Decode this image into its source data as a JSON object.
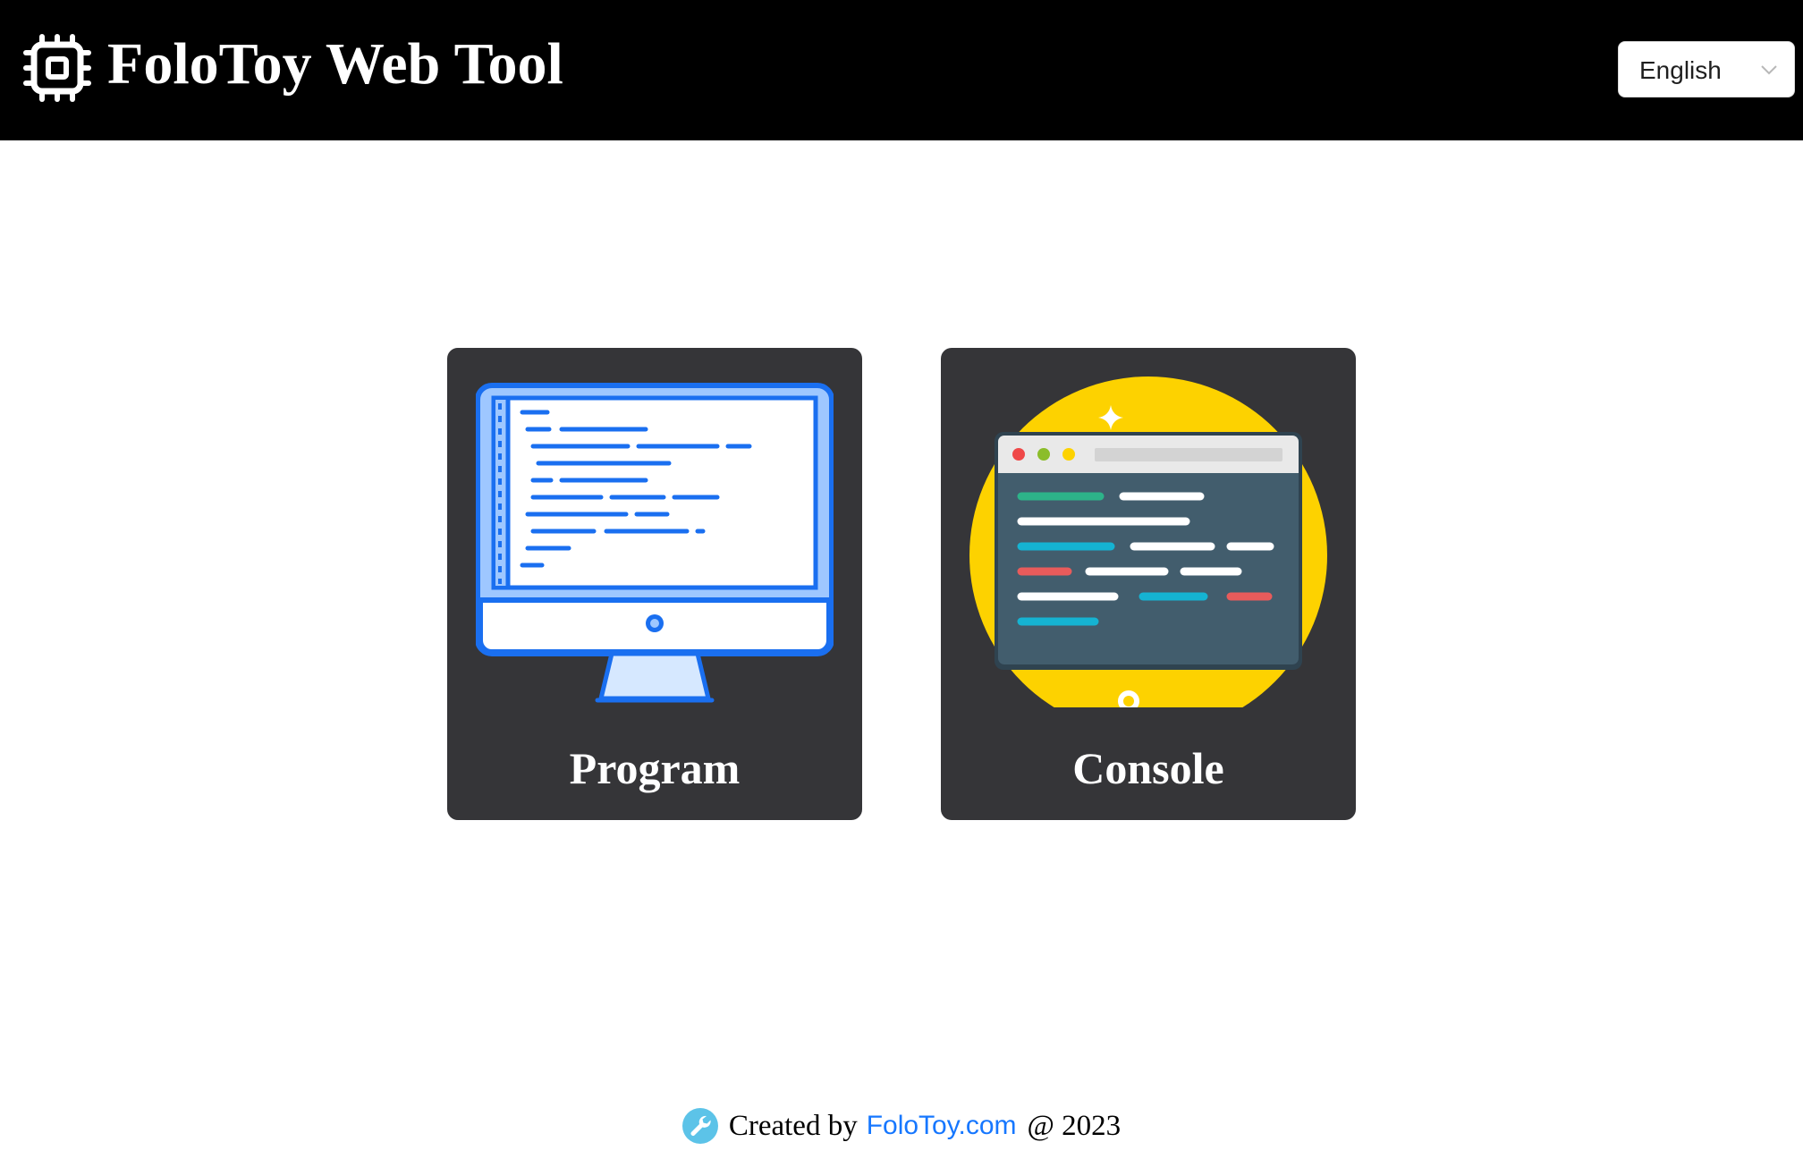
{
  "header": {
    "title": "FoloToy Web Tool",
    "logo_icon": "chip-icon",
    "language_select": {
      "value": "English",
      "icon": "chevron-down-icon"
    }
  },
  "cards": [
    {
      "label": "Program",
      "icon": "monitor-code-icon"
    },
    {
      "label": "Console",
      "icon": "terminal-window-icon"
    }
  ],
  "footer": {
    "prefix": "Created by",
    "link_text": "FoloToy.com",
    "suffix": "@ 2023",
    "icon": "wrench-icon"
  },
  "colors": {
    "header_bg": "#000000",
    "card_bg": "#353538",
    "link": "#1677ff",
    "program_accent": "#1a6ff0",
    "console_circle": "#fdd200"
  }
}
